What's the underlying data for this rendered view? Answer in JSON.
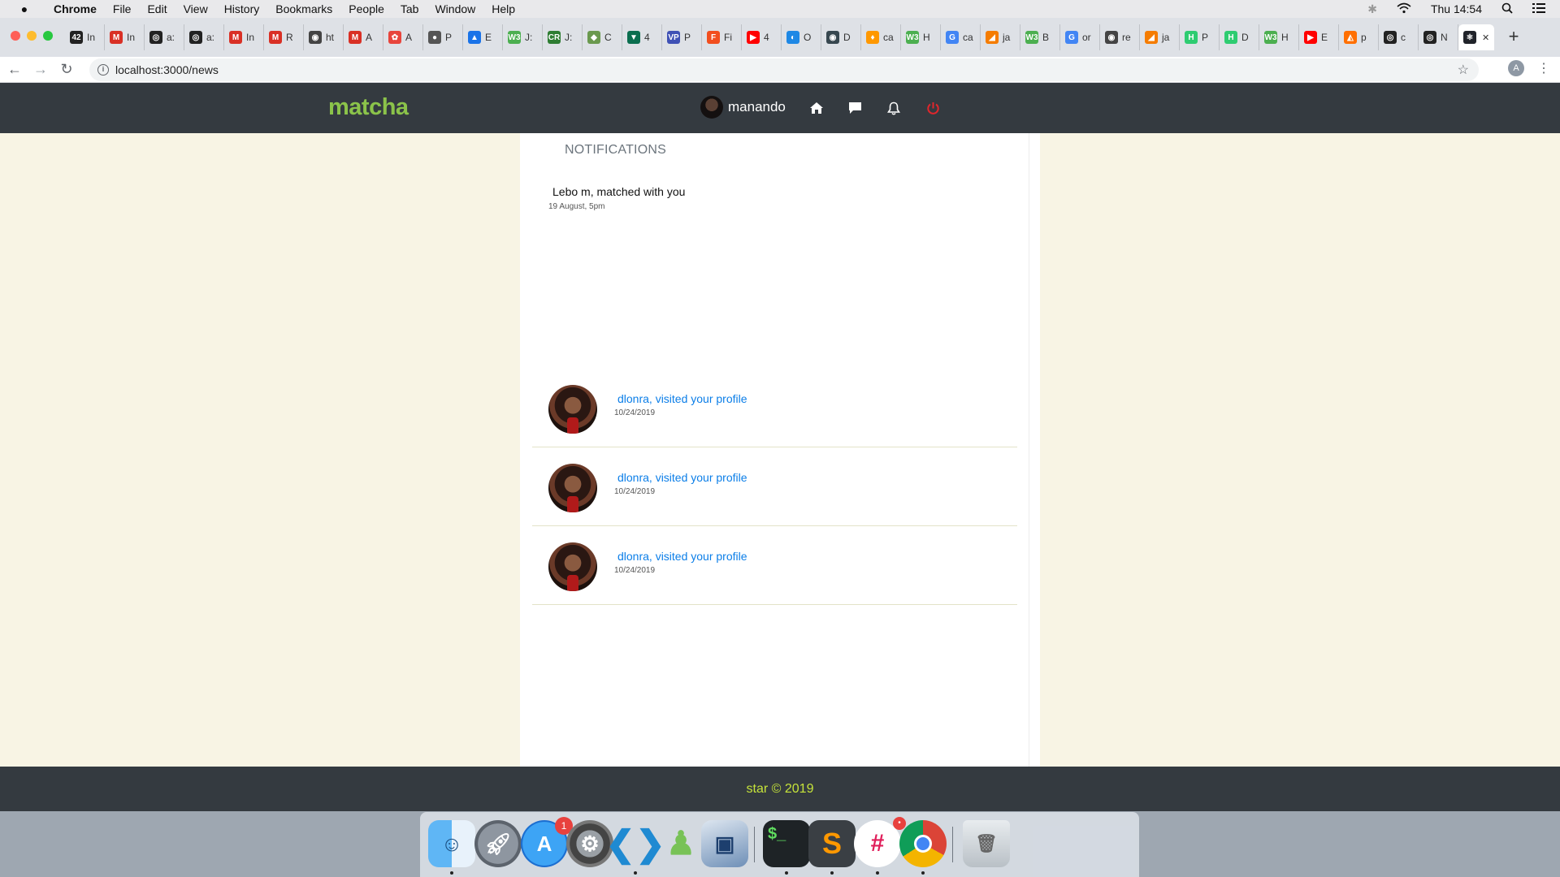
{
  "os_menubar": {
    "app": "Chrome",
    "menus": [
      "File",
      "Edit",
      "View",
      "History",
      "Bookmarks",
      "People",
      "Tab",
      "Window",
      "Help"
    ],
    "clock": "Thu 14:54"
  },
  "browser": {
    "tabs": [
      {
        "fav": "42",
        "label": "In",
        "color": "#222222"
      },
      {
        "fav": "M",
        "label": "In",
        "color": "#d93025"
      },
      {
        "fav": "◎",
        "label": "a:",
        "color": "#222222"
      },
      {
        "fav": "◎",
        "label": "a:",
        "color": "#222222"
      },
      {
        "fav": "M",
        "label": "In",
        "color": "#d93025"
      },
      {
        "fav": "M",
        "label": "R",
        "color": "#d93025"
      },
      {
        "fav": "◉",
        "label": "ht",
        "color": "#444444"
      },
      {
        "fav": "M",
        "label": "A",
        "color": "#d93025"
      },
      {
        "fav": "✿",
        "label": "A",
        "color": "#e8453c"
      },
      {
        "fav": "●",
        "label": "P",
        "color": "#555555"
      },
      {
        "fav": "▲",
        "label": "E",
        "color": "#1a73e8"
      },
      {
        "fav": "W3",
        "label": "J:",
        "color": "#4caf50"
      },
      {
        "fav": "CR",
        "label": "J:",
        "color": "#2e7d32"
      },
      {
        "fav": "◆",
        "label": "C",
        "color": "#6a994e"
      },
      {
        "fav": "▼",
        "label": "4",
        "color": "#0b6e4f"
      },
      {
        "fav": "VP",
        "label": "P",
        "color": "#3f51b5"
      },
      {
        "fav": "F",
        "label": "Fi",
        "color": "#f24e1e"
      },
      {
        "fav": "▶",
        "label": "4",
        "color": "#ff0000"
      },
      {
        "fav": "◐",
        "label": "O",
        "color": "#1e88e5"
      },
      {
        "fav": "◉",
        "label": "D",
        "color": "#37474f"
      },
      {
        "fav": "♦",
        "label": "ca",
        "color": "#ff9800"
      },
      {
        "fav": "W3",
        "label": "H",
        "color": "#4caf50"
      },
      {
        "fav": "G",
        "label": "ca",
        "color": "#4285f4"
      },
      {
        "fav": "◢",
        "label": "ja",
        "color": "#f57c00"
      },
      {
        "fav": "W3",
        "label": "B",
        "color": "#4caf50"
      },
      {
        "fav": "G",
        "label": "or",
        "color": "#4285f4"
      },
      {
        "fav": "◉",
        "label": "re",
        "color": "#444444"
      },
      {
        "fav": "◢",
        "label": "ja",
        "color": "#f57c00"
      },
      {
        "fav": "H",
        "label": "P",
        "color": "#2ecc71"
      },
      {
        "fav": "H",
        "label": "D",
        "color": "#2ecc71"
      },
      {
        "fav": "W3",
        "label": "H",
        "color": "#4caf50"
      },
      {
        "fav": "▶",
        "label": "E",
        "color": "#ff0000"
      },
      {
        "fav": "◭",
        "label": "p",
        "color": "#ff6f00"
      },
      {
        "fav": "◎",
        "label": "c",
        "color": "#222222"
      },
      {
        "fav": "◎",
        "label": "N",
        "color": "#222222"
      },
      {
        "fav": "⚛",
        "label": "",
        "color": "#20232a"
      }
    ],
    "url": "localhost:3000/news",
    "profile_initial": "A"
  },
  "site": {
    "logo": "matcha",
    "username": "manando",
    "nav_icons": [
      "home-icon",
      "chat-icon",
      "bell-icon",
      "power-icon"
    ],
    "accent": "#8bc34a"
  },
  "notifications": {
    "title": "NOTIFICATIONS",
    "match": {
      "text": "Lebo m, matched with you",
      "time": "19 August, 5pm"
    },
    "visits": [
      {
        "text": "dlonra, visited your profile",
        "date": "10/24/2019"
      },
      {
        "text": "dlonra, visited your profile",
        "date": "10/24/2019"
      },
      {
        "text": "dlonra, visited your profile",
        "date": "10/24/2019"
      }
    ]
  },
  "footer": {
    "text": "star © 2019"
  },
  "dock": {
    "apps": [
      "Finder",
      "Launchpad",
      "App Store",
      "System Preferences",
      "Visual Studio Code",
      "Android Studio",
      "VirtualBox",
      "Terminal",
      "Sublime Text",
      "Slack",
      "Google Chrome",
      "Trash"
    ],
    "app_store_badge": "1"
  }
}
